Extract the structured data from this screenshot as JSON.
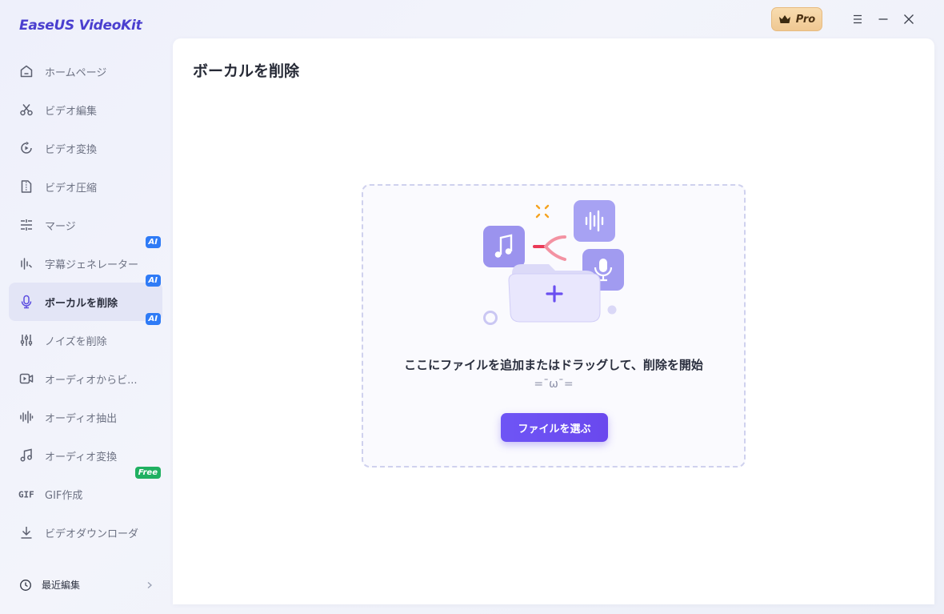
{
  "app": {
    "title": "EaseUS VideoKit",
    "pro_label": "Pro"
  },
  "sidebar": {
    "items": [
      {
        "label": "ホームページ",
        "icon": "home-icon"
      },
      {
        "label": "ビデオ編集",
        "icon": "scissors-icon"
      },
      {
        "label": "ビデオ変換",
        "icon": "video-convert-icon"
      },
      {
        "label": "ビデオ圧縮",
        "icon": "zip-file-icon"
      },
      {
        "label": "マージ",
        "icon": "merge-icon"
      },
      {
        "label": "字幕ジェネレーター",
        "icon": "subtitle-icon",
        "tag": "AI"
      },
      {
        "label": "ボーカルを削除",
        "icon": "microphone-icon",
        "tag": "AI",
        "active": true
      },
      {
        "label": "ノイズを削除",
        "icon": "sliders-icon",
        "tag": "AI"
      },
      {
        "label": "オーディオからビ...",
        "icon": "video-camera-icon"
      },
      {
        "label": "オーディオ抽出",
        "icon": "waveform-icon"
      },
      {
        "label": "オーディオ変換",
        "icon": "music-note-icon"
      },
      {
        "label": "GIF作成",
        "icon": "gif-icon",
        "tag": "Free"
      },
      {
        "label": "ビデオダウンローダ",
        "icon": "download-icon"
      }
    ],
    "recent_label": "最近編集"
  },
  "main": {
    "title": "ボーカルを削除",
    "dropzone": {
      "text": "ここにファイルを追加またはドラッグして、削除を開始",
      "subtext": "=¯ω¯=",
      "button_label": "ファイルを選ぶ"
    }
  },
  "colors": {
    "accent": "#6a4ff0",
    "ai_tag": "#2f7bf6",
    "free_tag": "#20b061",
    "pro_gold": "#f2cf9c"
  }
}
